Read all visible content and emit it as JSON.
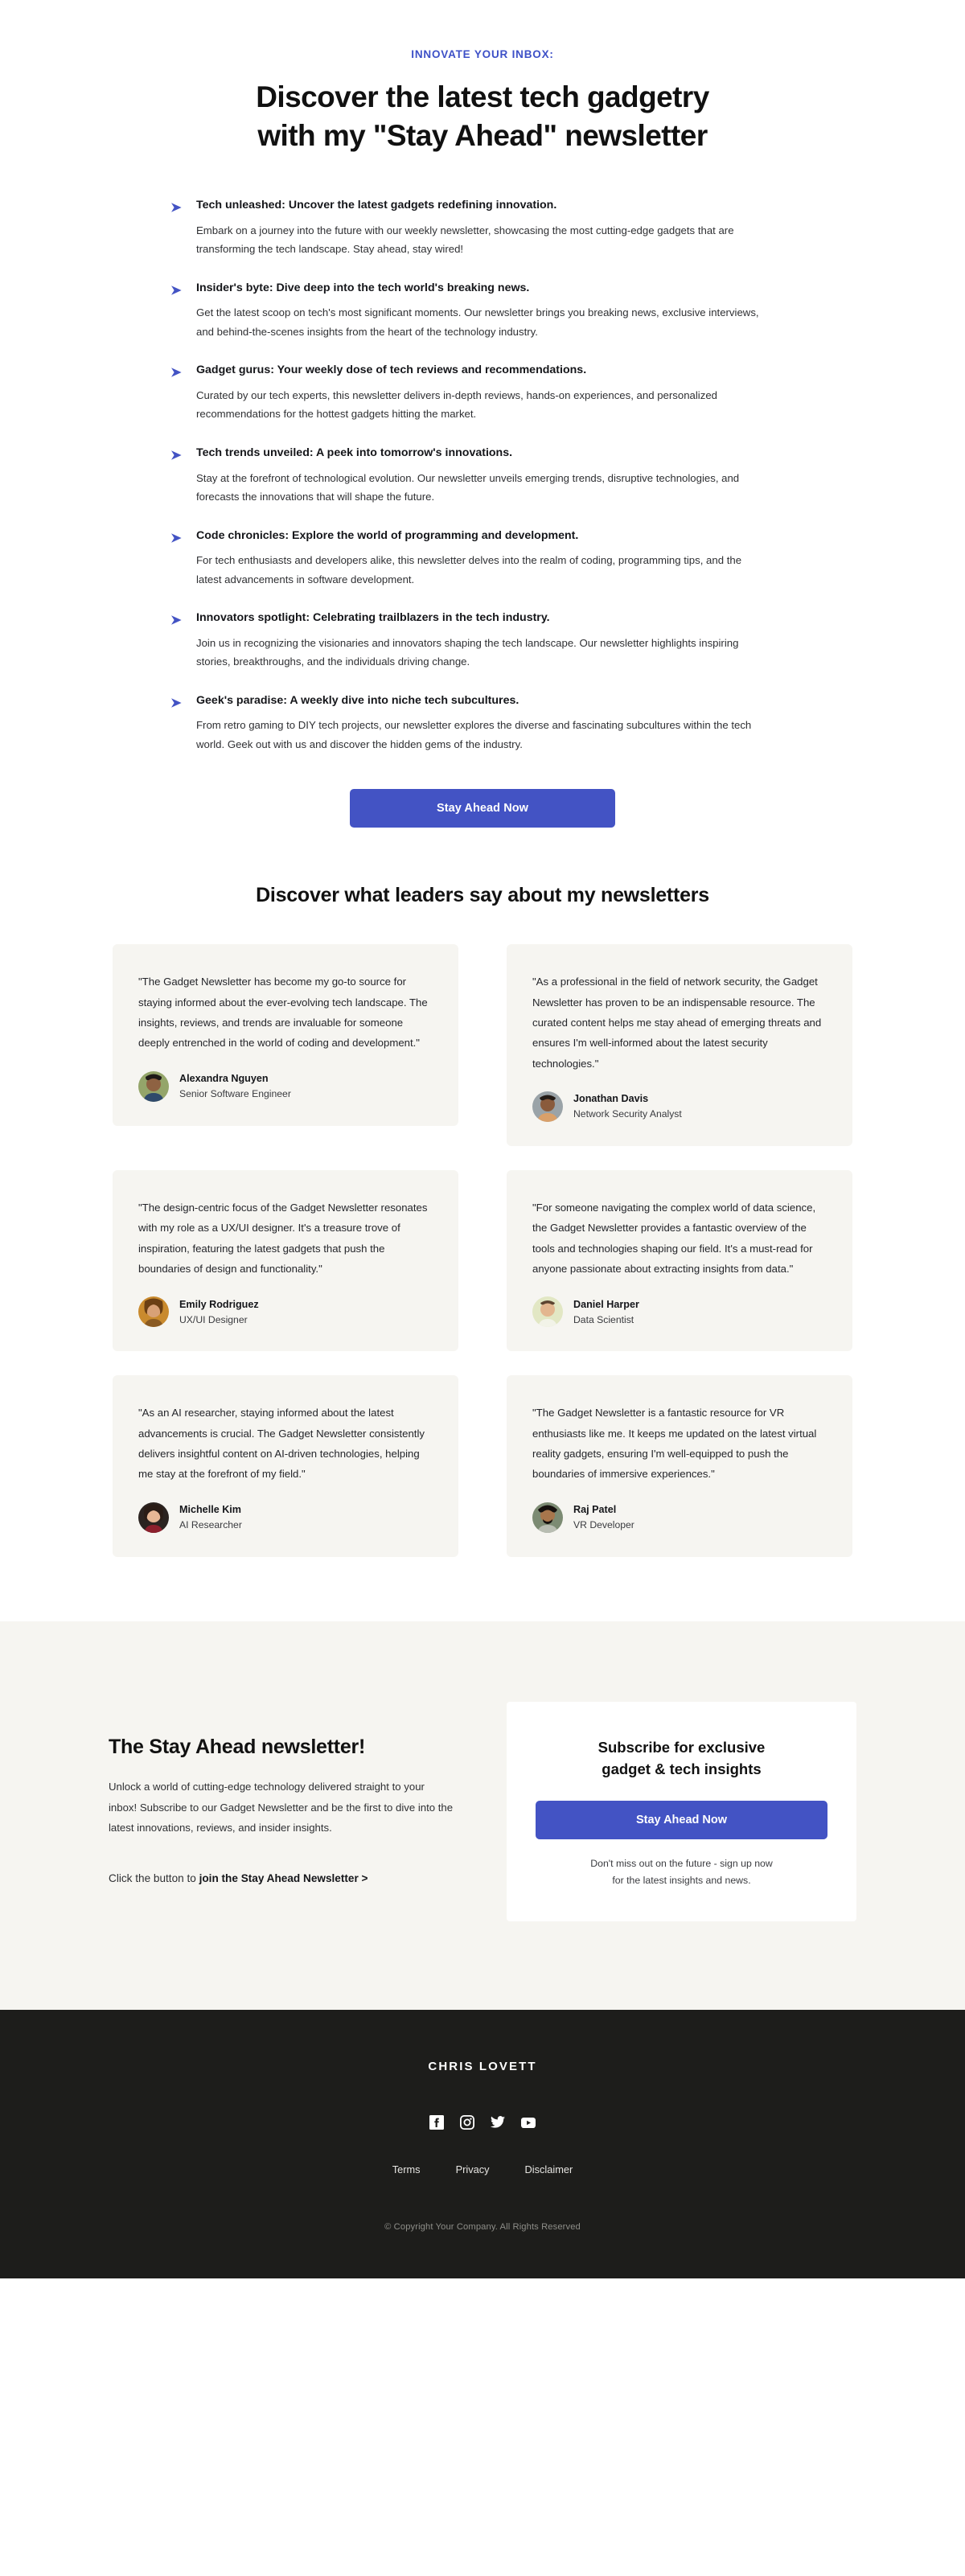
{
  "hero": {
    "eyebrow": "INNOVATE YOUR INBOX:",
    "title_line1": "Discover the latest tech gadgetry",
    "title_line2": "with my \"Stay Ahead\" newsletter",
    "accent_color": "#3d50c7"
  },
  "features": [
    {
      "bullet_icon": "arrow-right-icon",
      "title": "Tech unleashed: Uncover the latest gadgets redefining innovation.",
      "desc": "Embark on a journey into the future with our weekly newsletter, showcasing the most cutting-edge gadgets that are transforming the tech landscape. Stay ahead, stay wired!"
    },
    {
      "bullet_icon": "arrow-right-icon",
      "title": "Insider's byte: Dive deep into the tech world's breaking news.",
      "desc": "Get the latest scoop on tech's most significant moments. Our newsletter brings you breaking news, exclusive interviews, and behind-the-scenes insights from the heart of the technology industry."
    },
    {
      "bullet_icon": "arrow-right-icon",
      "title": "Gadget gurus: Your weekly dose of tech reviews and recommendations.",
      "desc": "Curated by our tech experts, this newsletter delivers in-depth reviews, hands-on experiences, and personalized recommendations for the hottest gadgets hitting the market."
    },
    {
      "bullet_icon": "arrow-right-icon",
      "title": "Tech trends unveiled: A peek into tomorrow's innovations.",
      "desc": "Stay at the forefront of technological evolution. Our newsletter unveils emerging trends, disruptive technologies, and forecasts the innovations that will shape the future."
    },
    {
      "bullet_icon": "arrow-right-icon",
      "title": "Code chronicles: Explore the world of programming and development.",
      "desc": "For tech enthusiasts and developers alike, this newsletter delves into the realm of coding, programming tips, and the latest advancements in software development."
    },
    {
      "bullet_icon": "arrow-right-icon",
      "title": "Innovators spotlight: Celebrating trailblazers in the tech industry.",
      "desc": "Join us in recognizing the visionaries and innovators shaping the tech landscape. Our newsletter highlights inspiring stories, breakthroughs, and the individuals driving change."
    },
    {
      "bullet_icon": "arrow-right-icon",
      "title": "Geek's paradise: A weekly dive into niche tech subcultures.",
      "desc": "From retro gaming to DIY tech projects, our newsletter explores the diverse and fascinating subcultures within the tech world. Geek out with us and discover the hidden gems of the industry."
    }
  ],
  "primary_cta": {
    "label": "Stay Ahead Now",
    "bg_color": "#4353c4",
    "text_color": "#ffffff"
  },
  "testimonials": {
    "title": "Discover what leaders say about my newsletters",
    "card_bg": "#f6f5f1",
    "items": [
      {
        "quote": "\"The Gadget Newsletter has become my go-to source for staying informed about the ever-evolving tech landscape. The insights, reviews, and trends are invaluable for someone deeply entrenched in the world of coding and development.\"",
        "name": "Alexandra Nguyen",
        "role": "Senior Software Engineer",
        "avatar_name": "avatar-alexandra-nguyen",
        "avatar_bg": "#94a56a",
        "avatar_skin": "#8e6242",
        "avatar_hair": "#1f1a18"
      },
      {
        "quote": "\"As a professional in the field of network security, the Gadget Newsletter has proven to be an indispensable resource. The curated content helps me stay ahead of emerging threats and ensures I'm well-informed about the latest security technologies.\"",
        "name": "Jonathan Davis",
        "role": "Network Security Analyst",
        "avatar_name": "avatar-jonathan-davis",
        "avatar_bg": "#9aa3a8",
        "avatar_skin": "#8a5b3c",
        "avatar_hair": "#241c17"
      },
      {
        "quote": "\"The design-centric focus of the Gadget Newsletter resonates with my role as a UX/UI designer. It's a treasure trove of inspiration, featuring the latest gadgets that push the boundaries of design and functionality.\"",
        "name": "Emily Rodriguez",
        "role": "UX/UI Designer",
        "avatar_name": "avatar-emily-rodriguez",
        "avatar_bg": "#c98a2e",
        "avatar_skin": "#d8a177",
        "avatar_hair": "#6b3f14"
      },
      {
        "quote": "\"For someone navigating the complex world of data science, the Gadget Newsletter provides a fantastic overview of the tools and technologies shaping our field. It's a must-read for anyone passionate about extracting insights from data.\"",
        "name": "Daniel Harper",
        "role": "Data Scientist",
        "avatar_name": "avatar-daniel-harper",
        "avatar_bg": "#e2e7c4",
        "avatar_skin": "#e3b68f",
        "avatar_hair": "#5d4430"
      },
      {
        "quote": "\"As an AI researcher, staying informed about the latest advancements is crucial. The Gadget Newsletter consistently delivers insightful content on AI-driven technologies, helping me stay at the forefront of my field.\"",
        "name": "Michelle Kim",
        "role": "AI Researcher",
        "avatar_name": "avatar-michelle-kim",
        "avatar_bg": "#2b2320",
        "avatar_skin": "#e6b795",
        "avatar_hair": "#2a1c16"
      },
      {
        "quote": "\"The Gadget Newsletter is a fantastic resource for VR enthusiasts like me. It keeps me updated on the latest virtual reality gadgets, ensuring I'm well-equipped to push the boundaries of immersive experiences.\"",
        "name": "Raj Patel",
        "role": "VR Developer",
        "avatar_name": "avatar-raj-patel",
        "avatar_bg": "#7c8b73",
        "avatar_skin": "#a8764c",
        "avatar_hair": "#16110e"
      }
    ]
  },
  "subscribe_band": {
    "bg_color": "#f6f5f1",
    "title": "The Stay Ahead newsletter!",
    "body": "Unlock a world of cutting-edge technology delivered straight to your inbox! Subscribe to our Gadget Newsletter and be the first to dive into the latest innovations, reviews, and insider insights.",
    "link_prefix": "Click the button to ",
    "link_label": "join the Stay Ahead Newsletter >",
    "card": {
      "title_line1": "Subscribe for exclusive",
      "title_line2": "gadget & tech insights",
      "button_label": "Stay Ahead Now",
      "note_line1": "Don't miss out on the future - sign up now",
      "note_line2": "for the latest insights and news."
    }
  },
  "footer": {
    "bg_color": "#1d1d1b",
    "brand": "CHRIS LOVETT",
    "social": [
      {
        "icon": "facebook-icon",
        "label": "Facebook"
      },
      {
        "icon": "instagram-icon",
        "label": "Instagram"
      },
      {
        "icon": "twitter-icon",
        "label": "Twitter"
      },
      {
        "icon": "youtube-icon",
        "label": "YouTube"
      }
    ],
    "links": [
      "Terms",
      "Privacy",
      "Disclaimer"
    ],
    "copyright": "© Copyright Your Company. All Rights Reserved"
  }
}
